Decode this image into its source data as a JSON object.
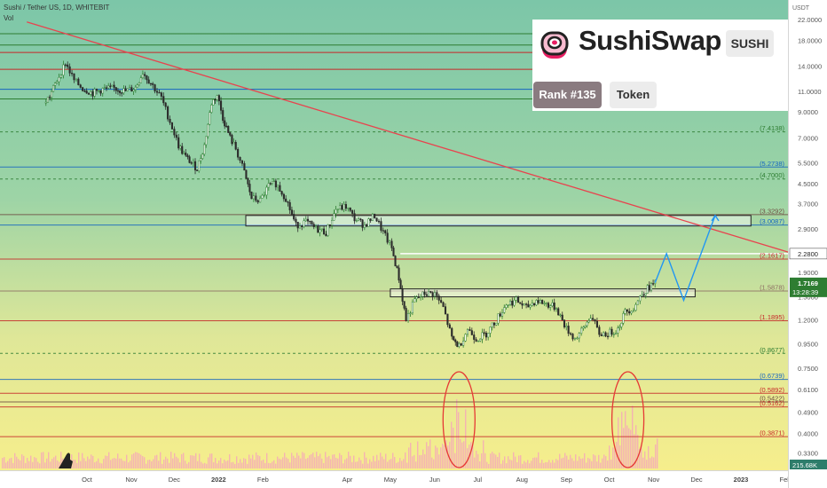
{
  "header": {
    "title": "Sushi / Tether US, 1D, WHITEBIT",
    "vol_label": "Vol"
  },
  "logo_card": {
    "name": "SushiSwap",
    "ticker": "SUSHI",
    "rank": "Rank #135",
    "type": "Token",
    "icon": "sushi-roll-icon"
  },
  "colors": {
    "upper_bg": "#89c9a8",
    "lower_bg": "#f3ec92",
    "trendline": "#e8434e",
    "projection": "#2196f3",
    "candle_up": "#2e7d32",
    "candle_down": "#2b2b2b",
    "volume": "#f5a9b8",
    "ellipse": "#e53935",
    "current_price_bg": "#2e7d32",
    "volume_label_bg": "#2e7d6b"
  },
  "chart_data": {
    "type": "candlestick",
    "title": "Sushi / Tether US, 1D, WHITEBIT",
    "y_scale": "log",
    "ylim": [
      0.31,
      24
    ],
    "x_labels": [
      "Oct",
      "Nov",
      "Dec",
      "2022",
      "Feb",
      "Apr",
      "May",
      "Jun",
      "Jul",
      "Aug",
      "Sep",
      "Oct",
      "Nov",
      "Dec",
      "2023",
      "Feb"
    ],
    "x_label_positions_months": [
      "2021-10",
      "2021-11",
      "2021-12",
      "2022-01",
      "2022-02",
      "2022-04",
      "2022-05",
      "2022-06",
      "2022-07",
      "2022-08",
      "2022-09",
      "2022-10",
      "2022-11",
      "2022-12",
      "2023-01",
      "2023-02"
    ],
    "y_ticks": [
      "22.0000",
      "18.0000",
      "14.0000",
      "11.0000",
      "9.0000",
      "7.0000",
      "5.5000",
      "4.5000",
      "3.7000",
      "2.9000",
      "2.2800",
      "1.9000",
      "1.5000",
      "1.2000",
      "0.9500",
      "0.7500",
      "0.6100",
      "0.4900",
      "0.4000",
      "0.3300"
    ],
    "unit_label": "USDT",
    "current_price": "1.7169",
    "countdown": "13:28:39",
    "volume_label": "215.68K",
    "price_path": [
      {
        "date": "2021-09-01",
        "price": 9.8
      },
      {
        "date": "2021-09-05",
        "price": 10.5
      },
      {
        "date": "2021-09-10",
        "price": 12.2
      },
      {
        "date": "2021-09-16",
        "price": 14.5
      },
      {
        "date": "2021-09-22",
        "price": 12.2
      },
      {
        "date": "2021-09-28",
        "price": 11.3
      },
      {
        "date": "2021-10-05",
        "price": 10.8
      },
      {
        "date": "2021-10-12",
        "price": 11.2
      },
      {
        "date": "2021-10-20",
        "price": 11.3
      },
      {
        "date": "2021-10-28",
        "price": 11.0
      },
      {
        "date": "2021-11-04",
        "price": 11.4
      },
      {
        "date": "2021-11-09",
        "price": 13.2
      },
      {
        "date": "2021-11-16",
        "price": 11.6
      },
      {
        "date": "2021-11-22",
        "price": 10.3
      },
      {
        "date": "2021-11-28",
        "price": 8.2
      },
      {
        "date": "2021-12-04",
        "price": 6.5
      },
      {
        "date": "2021-12-09",
        "price": 5.8
      },
      {
        "date": "2021-12-13",
        "price": 5.5
      },
      {
        "date": "2021-12-17",
        "price": 5.2
      },
      {
        "date": "2021-12-22",
        "price": 6.5
      },
      {
        "date": "2021-12-27",
        "price": 9.8
      },
      {
        "date": "2021-12-31",
        "price": 10.6
      },
      {
        "date": "2022-01-04",
        "price": 8.5
      },
      {
        "date": "2022-01-09",
        "price": 7.0
      },
      {
        "date": "2022-01-13",
        "price": 6.3
      },
      {
        "date": "2022-01-19",
        "price": 5.0
      },
      {
        "date": "2022-01-24",
        "price": 3.9
      },
      {
        "date": "2022-01-30",
        "price": 3.8
      },
      {
        "date": "2022-02-05",
        "price": 4.4
      },
      {
        "date": "2022-02-10",
        "price": 4.5
      },
      {
        "date": "2022-02-17",
        "price": 3.9
      },
      {
        "date": "2022-02-24",
        "price": 3.0
      },
      {
        "date": "2022-03-03",
        "price": 3.1
      },
      {
        "date": "2022-03-10",
        "price": 2.9
      },
      {
        "date": "2022-03-17",
        "price": 2.8
      },
      {
        "date": "2022-03-24",
        "price": 3.5
      },
      {
        "date": "2022-03-31",
        "price": 3.6
      },
      {
        "date": "2022-04-06",
        "price": 3.2
      },
      {
        "date": "2022-04-13",
        "price": 3.0
      },
      {
        "date": "2022-04-20",
        "price": 3.3
      },
      {
        "date": "2022-04-26",
        "price": 2.8
      },
      {
        "date": "2022-05-02",
        "price": 2.4
      },
      {
        "date": "2022-05-07",
        "price": 1.8
      },
      {
        "date": "2022-05-12",
        "price": 1.2
      },
      {
        "date": "2022-05-18",
        "price": 1.45
      },
      {
        "date": "2022-05-25",
        "price": 1.55
      },
      {
        "date": "2022-06-01",
        "price": 1.55
      },
      {
        "date": "2022-06-07",
        "price": 1.35
      },
      {
        "date": "2022-06-13",
        "price": 1.0
      },
      {
        "date": "2022-06-18",
        "price": 0.93
      },
      {
        "date": "2022-06-24",
        "price": 1.1
      },
      {
        "date": "2022-06-30",
        "price": 1.0
      },
      {
        "date": "2022-07-07",
        "price": 1.05
      },
      {
        "date": "2022-07-14",
        "price": 1.2
      },
      {
        "date": "2022-07-21",
        "price": 1.4
      },
      {
        "date": "2022-07-28",
        "price": 1.45
      },
      {
        "date": "2022-08-04",
        "price": 1.35
      },
      {
        "date": "2022-08-11",
        "price": 1.45
      },
      {
        "date": "2022-08-18",
        "price": 1.4
      },
      {
        "date": "2022-08-25",
        "price": 1.35
      },
      {
        "date": "2022-09-01",
        "price": 1.1
      },
      {
        "date": "2022-09-07",
        "price": 1.0
      },
      {
        "date": "2022-09-13",
        "price": 1.1
      },
      {
        "date": "2022-09-18",
        "price": 1.25
      },
      {
        "date": "2022-09-24",
        "price": 1.05
      },
      {
        "date": "2022-09-30",
        "price": 1.05
      },
      {
        "date": "2022-10-07",
        "price": 1.1
      },
      {
        "date": "2022-10-12",
        "price": 1.3
      },
      {
        "date": "2022-10-18",
        "price": 1.35
      },
      {
        "date": "2022-10-24",
        "price": 1.55
      },
      {
        "date": "2022-10-29",
        "price": 1.65
      },
      {
        "date": "2022-11-02",
        "price": 1.72
      }
    ],
    "projection_path": [
      {
        "date": "2022-11-02",
        "price": 1.72
      },
      {
        "date": "2022-11-10",
        "price": 2.28
      },
      {
        "date": "2022-11-22",
        "price": 1.45
      },
      {
        "date": "2022-12-14",
        "price": 3.3
      }
    ],
    "trendline": [
      {
        "date": "2021-08-20",
        "price": 21.5
      },
      {
        "date": "2023-02-15",
        "price": 2.2
      }
    ],
    "fib_levels": [
      {
        "label": "(7.4138)",
        "value": 7.4138,
        "color": "#2e7d32"
      },
      {
        "label": "(5.2738)",
        "value": 5.2738,
        "color": "#1565c0"
      },
      {
        "label": "(4.7000)",
        "value": 4.7,
        "color": "#2e7d32"
      },
      {
        "label": "(3.3292)",
        "value": 3.3292,
        "color": "#6d4c41"
      },
      {
        "label": "(3.0087)",
        "value": 3.0087,
        "color": "#1565c0"
      },
      {
        "label": "(2.1617)",
        "value": 2.1617,
        "color": "#c62828"
      },
      {
        "label": "(1.5878)",
        "value": 1.5878,
        "color": "#8d6e63"
      },
      {
        "label": "(1.1895)",
        "value": 1.1895,
        "color": "#c62828"
      },
      {
        "label": "(0.8677)",
        "value": 0.8677,
        "color": "#2e7d32"
      },
      {
        "label": "(0.6739)",
        "value": 0.6739,
        "color": "#1565c0"
      },
      {
        "label": "(0.5892)",
        "value": 0.5892,
        "color": "#c62828"
      },
      {
        "label": "(0.5422)",
        "value": 0.5422,
        "color": "#6d4c41"
      },
      {
        "label": "(0.5162)",
        "value": 0.5162,
        "color": "#c62828"
      },
      {
        "label": "(0.3871)",
        "value": 0.3871,
        "color": "#c62828"
      }
    ],
    "upper_lines": [
      {
        "value": 19.2,
        "color": "#2e7d32"
      },
      {
        "value": 17.2,
        "color": "#2e7d32"
      },
      {
        "value": 16.0,
        "color": "#c62828"
      },
      {
        "value": 13.6,
        "color": "#c62828"
      },
      {
        "value": 11.2,
        "color": "#1565c0"
      },
      {
        "value": 10.2,
        "color": "#2e7d32"
      }
    ],
    "resistance_zones": [
      {
        "from_date": "2022-01-20",
        "to_date": "2023-01-08",
        "low": 2.98,
        "high": 3.3
      },
      {
        "from_date": "2022-05-01",
        "to_date": "2022-11-30",
        "low": 1.5,
        "high": 1.62
      }
    ],
    "target_level": {
      "value": 2.28,
      "from_date": "2022-05-08",
      "to_date": "2023-02-15"
    },
    "highlighted_volume_spikes": [
      {
        "date": "2022-06-18"
      },
      {
        "date": "2022-10-14"
      }
    ]
  }
}
